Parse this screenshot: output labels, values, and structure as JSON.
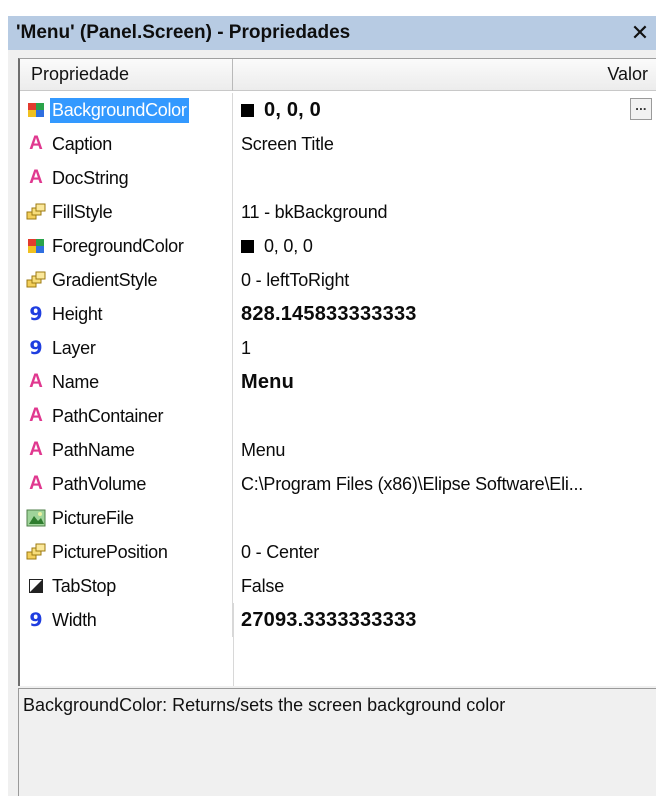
{
  "window": {
    "title": "'Menu' (Panel.Screen) - Propriedades",
    "close_glyph": "✕"
  },
  "grid": {
    "header_property": "Propriedade",
    "header_value": "Valor",
    "selected_row": "BackgroundColor",
    "rows": [
      {
        "name": "BackgroundColor",
        "icon": "color-icon",
        "value": "0, 0, 0",
        "bold": true,
        "swatch": true,
        "ellipsis": "..."
      },
      {
        "name": "Caption",
        "icon": "string-icon",
        "value": "Screen Title"
      },
      {
        "name": "DocString",
        "icon": "string-icon",
        "value": ""
      },
      {
        "name": "FillStyle",
        "icon": "enum-icon",
        "value": "11 - bkBackground"
      },
      {
        "name": "ForegroundColor",
        "icon": "color-icon",
        "value": "0, 0, 0",
        "swatch": true
      },
      {
        "name": "GradientStyle",
        "icon": "enum-icon",
        "value": "0 - leftToRight"
      },
      {
        "name": "Height",
        "icon": "number-icon",
        "value": "828.145833333333",
        "bold": true
      },
      {
        "name": "Layer",
        "icon": "number-icon",
        "value": "1"
      },
      {
        "name": "Name",
        "icon": "string-icon",
        "value": "Menu",
        "bold": true
      },
      {
        "name": "PathContainer",
        "icon": "string-icon",
        "value": ""
      },
      {
        "name": "PathName",
        "icon": "string-icon",
        "value": "Menu"
      },
      {
        "name": "PathVolume",
        "icon": "string-icon",
        "value": "C:\\Program Files (x86)\\Elipse Software\\Eli..."
      },
      {
        "name": "PictureFile",
        "icon": "picture-icon",
        "value": ""
      },
      {
        "name": "PicturePosition",
        "icon": "enum-icon",
        "value": "0 - Center"
      },
      {
        "name": "TabStop",
        "icon": "boolean-icon",
        "value": "False"
      },
      {
        "name": "Width",
        "icon": "number-icon",
        "value": "27093.3333333333",
        "bold": true
      }
    ]
  },
  "description": "BackgroundColor: Returns/sets the screen background color",
  "colors": {
    "titlebar": "#b7cbe3",
    "selection": "#3399ff",
    "string_icon": "#e0388f",
    "number_icon": "#1f3ee0"
  }
}
